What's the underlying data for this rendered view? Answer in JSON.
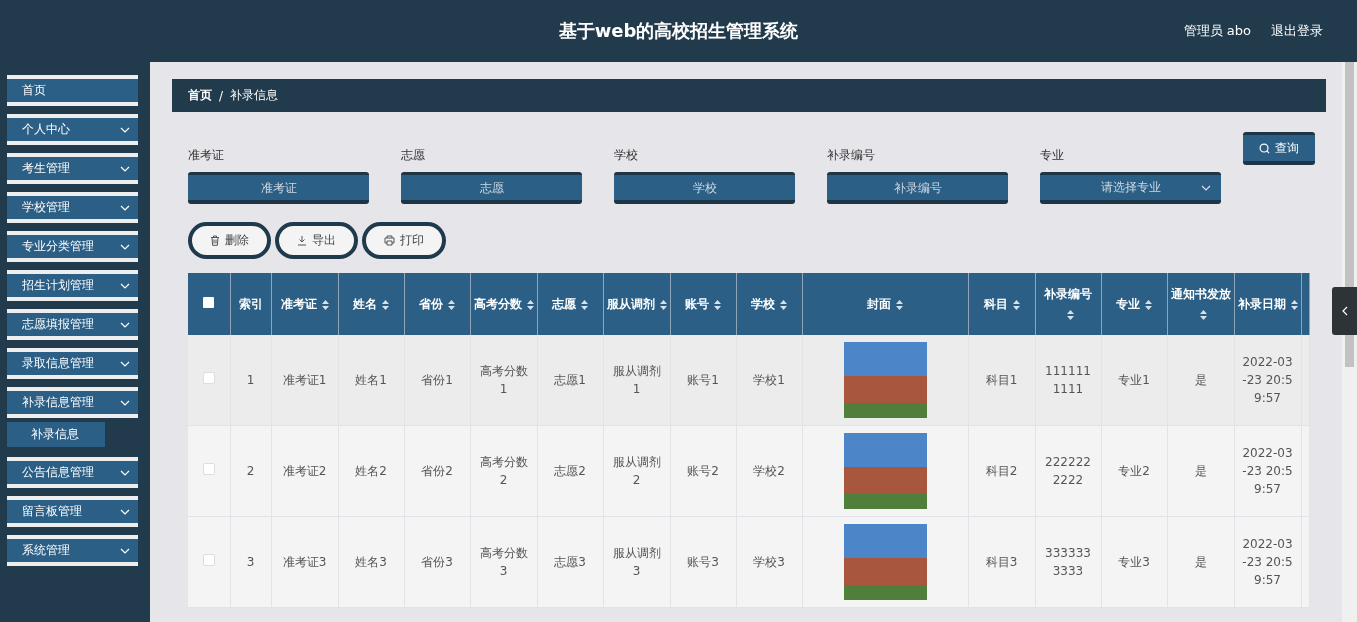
{
  "header": {
    "title": "基于web的高校招生管理系统",
    "user": "管理员 abo",
    "logout": "退出登录"
  },
  "sidebar": {
    "items": [
      {
        "label": "首页",
        "kind": "link"
      },
      {
        "label": "个人中心",
        "kind": "menu"
      },
      {
        "label": "考生管理",
        "kind": "menu"
      },
      {
        "label": "学校管理",
        "kind": "menu"
      },
      {
        "label": "专业分类管理",
        "kind": "menu"
      },
      {
        "label": "招生计划管理",
        "kind": "menu"
      },
      {
        "label": "志愿填报管理",
        "kind": "menu"
      },
      {
        "label": "录取信息管理",
        "kind": "menu"
      },
      {
        "label": "补录信息管理",
        "kind": "menu",
        "children": [
          {
            "label": "补录信息",
            "selected": true
          }
        ]
      },
      {
        "label": "公告信息管理",
        "kind": "menu"
      },
      {
        "label": "留言板管理",
        "kind": "menu"
      },
      {
        "label": "系统管理",
        "kind": "menu"
      }
    ]
  },
  "breadcrumb": {
    "items": [
      "首页",
      "补录信息"
    ],
    "separator": "/"
  },
  "filters": [
    {
      "label": "准考证",
      "placeholder": "准考证",
      "kind": "input"
    },
    {
      "label": "志愿",
      "placeholder": "志愿",
      "kind": "input"
    },
    {
      "label": "学校",
      "placeholder": "学校",
      "kind": "input"
    },
    {
      "label": "补录编号",
      "placeholder": "补录编号",
      "kind": "input"
    },
    {
      "label": "专业",
      "placeholder": "请选择专业",
      "kind": "select"
    }
  ],
  "search_button": "查询",
  "actions": [
    {
      "label": "删除",
      "kind": "delete"
    },
    {
      "label": "导出",
      "kind": "export"
    },
    {
      "label": "打印",
      "kind": "print"
    }
  ],
  "table": {
    "header_checked": false,
    "columns": [
      {
        "kind": "checkbox"
      },
      {
        "kind": "text",
        "label": "索引",
        "sortable": false
      },
      {
        "kind": "text",
        "label": "准考证",
        "sortable": true
      },
      {
        "kind": "text",
        "label": "姓名",
        "sortable": true
      },
      {
        "kind": "text",
        "label": "省份",
        "sortable": true
      },
      {
        "kind": "text",
        "label": "高考分数",
        "sortable": true
      },
      {
        "kind": "text",
        "label": "志愿",
        "sortable": true
      },
      {
        "kind": "text",
        "label": "服从调剂",
        "sortable": true
      },
      {
        "kind": "text",
        "label": "账号",
        "sortable": true
      },
      {
        "kind": "text",
        "label": "学校",
        "sortable": true
      },
      {
        "kind": "photo",
        "label": "封面",
        "sortable": true
      },
      {
        "kind": "text",
        "label": "科目",
        "sortable": true
      },
      {
        "kind": "text",
        "label": "补录编号",
        "sortable": true
      },
      {
        "kind": "text",
        "label": "专业",
        "sortable": true
      },
      {
        "kind": "text",
        "label": "通知书发放",
        "sortable": true
      },
      {
        "kind": "text",
        "label": "补录日期",
        "sortable": true
      }
    ],
    "rows": [
      {
        "checked": false,
        "cells": [
          "",
          "1",
          "准考证1",
          "姓名1",
          "省份1",
          "高考分数1",
          "志愿1",
          "服从调剂1",
          "账号1",
          "学校1",
          "",
          "科目1",
          "1111111111",
          "专业1",
          "是",
          "2022-03-23 20:59:57"
        ]
      },
      {
        "checked": false,
        "cells": [
          "",
          "2",
          "准考证2",
          "姓名2",
          "省份2",
          "高考分数2",
          "志愿2",
          "服从调剂2",
          "账号2",
          "学校2",
          "",
          "科目2",
          "2222222222",
          "专业2",
          "是",
          "2022-03-23 20:59:57"
        ]
      },
      {
        "checked": false,
        "cells": [
          "",
          "3",
          "准考证3",
          "姓名3",
          "省份3",
          "高考分数3",
          "志愿3",
          "服从调剂3",
          "账号3",
          "学校3",
          "",
          "科目3",
          "3333333333",
          "专业3",
          "是",
          "2022-03-23 20:59:57"
        ]
      }
    ]
  }
}
